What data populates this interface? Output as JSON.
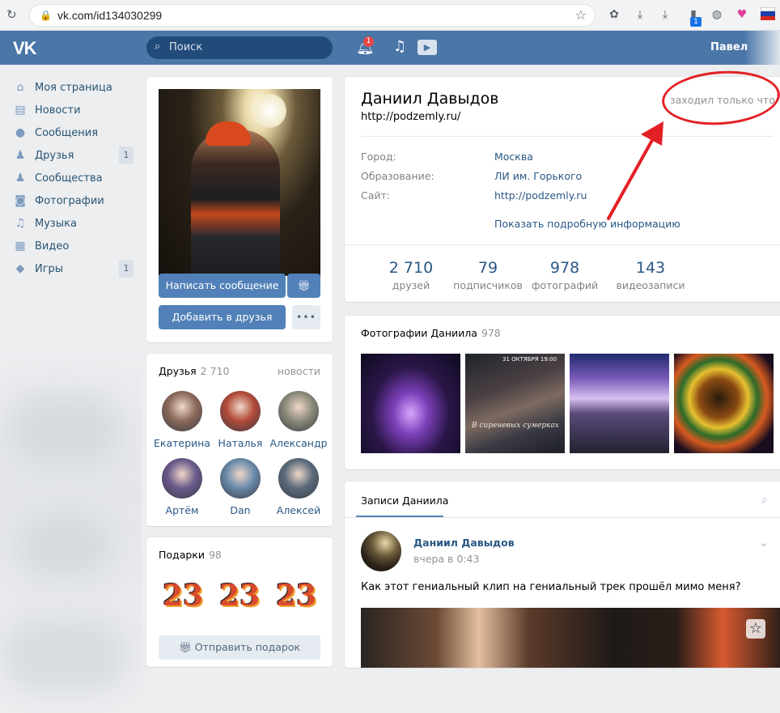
{
  "browser": {
    "url": "vk.com/id134030299",
    "ext_badge": "1"
  },
  "header": {
    "logo": "VK",
    "search_placeholder": "Поиск",
    "notif_count": "1",
    "user_name": "Павел"
  },
  "nav": [
    {
      "icon": "home-icon",
      "glyph": "⌂",
      "label": "Моя страница",
      "count": ""
    },
    {
      "icon": "news-icon",
      "glyph": "▤",
      "label": "Новости",
      "count": ""
    },
    {
      "icon": "messages-icon",
      "glyph": "●",
      "label": "Сообщения",
      "count": ""
    },
    {
      "icon": "friends-icon",
      "glyph": "♟",
      "label": "Друзья",
      "count": "1"
    },
    {
      "icon": "communities-icon",
      "glyph": "♟",
      "label": "Сообщества",
      "count": ""
    },
    {
      "icon": "photos-icon",
      "glyph": "◙",
      "label": "Фотографии",
      "count": ""
    },
    {
      "icon": "music-icon",
      "glyph": "♫",
      "label": "Музыка",
      "count": ""
    },
    {
      "icon": "video-icon",
      "glyph": "▦",
      "label": "Видео",
      "count": ""
    },
    {
      "icon": "games-icon",
      "glyph": "◆",
      "label": "Игры",
      "count": "1"
    }
  ],
  "profile_actions": {
    "send_message": "Написать сообщение",
    "add_friend": "Добавить в друзья",
    "more": "•••"
  },
  "friends_block": {
    "title": "Друзья",
    "count": "2 710",
    "link": "новости",
    "friends": [
      {
        "name": "Екатерина",
        "color": "#8a6a5a"
      },
      {
        "name": "Наталья",
        "color": "#b04a3a"
      },
      {
        "name": "Александр",
        "color": "#8a8a7a"
      },
      {
        "name": "Артём",
        "color": "#6a5a8a"
      },
      {
        "name": "Dan",
        "color": "#6a8aaa"
      },
      {
        "name": "Алексей",
        "color": "#5a6a7a"
      }
    ]
  },
  "gifts_block": {
    "title": "Подарки",
    "count": "98",
    "gift_glyph": "23",
    "send_gift": "Отправить подарок"
  },
  "profile": {
    "name": "Даниил Давыдов",
    "status": "http://podzemly.ru/",
    "online": "заходил только что",
    "rows": [
      {
        "key": "Город:",
        "value": "Москва"
      },
      {
        "key": "Образование:",
        "value": "ЛИ им. Горького"
      },
      {
        "key": "Сайт:",
        "value": "http://podzemly.ru"
      }
    ],
    "more_info": "Показать подробную информацию",
    "stats": [
      {
        "num": "2 710",
        "label": "друзей"
      },
      {
        "num": "79",
        "label": "подписчиков"
      },
      {
        "num": "978",
        "label": "фотографий"
      },
      {
        "num": "143",
        "label": "видеозаписи"
      }
    ]
  },
  "photos_block": {
    "title": "Фотографии Даниила",
    "count": "978",
    "photo2_caption": "В сиреневых сумерках",
    "photo2_date": "31 ОКТЯБРЯ 19:00"
  },
  "posts": {
    "tab": "Записи Даниила",
    "author": "Даниил Давыдов",
    "time": "вчера в 0:43",
    "text": "Как этот гениальный клип на гениальный трек прошёл мимо меня?"
  },
  "colors": {
    "vk_blue": "#4a76a8",
    "link": "#2a5885",
    "annotation_red": "#e32026"
  }
}
